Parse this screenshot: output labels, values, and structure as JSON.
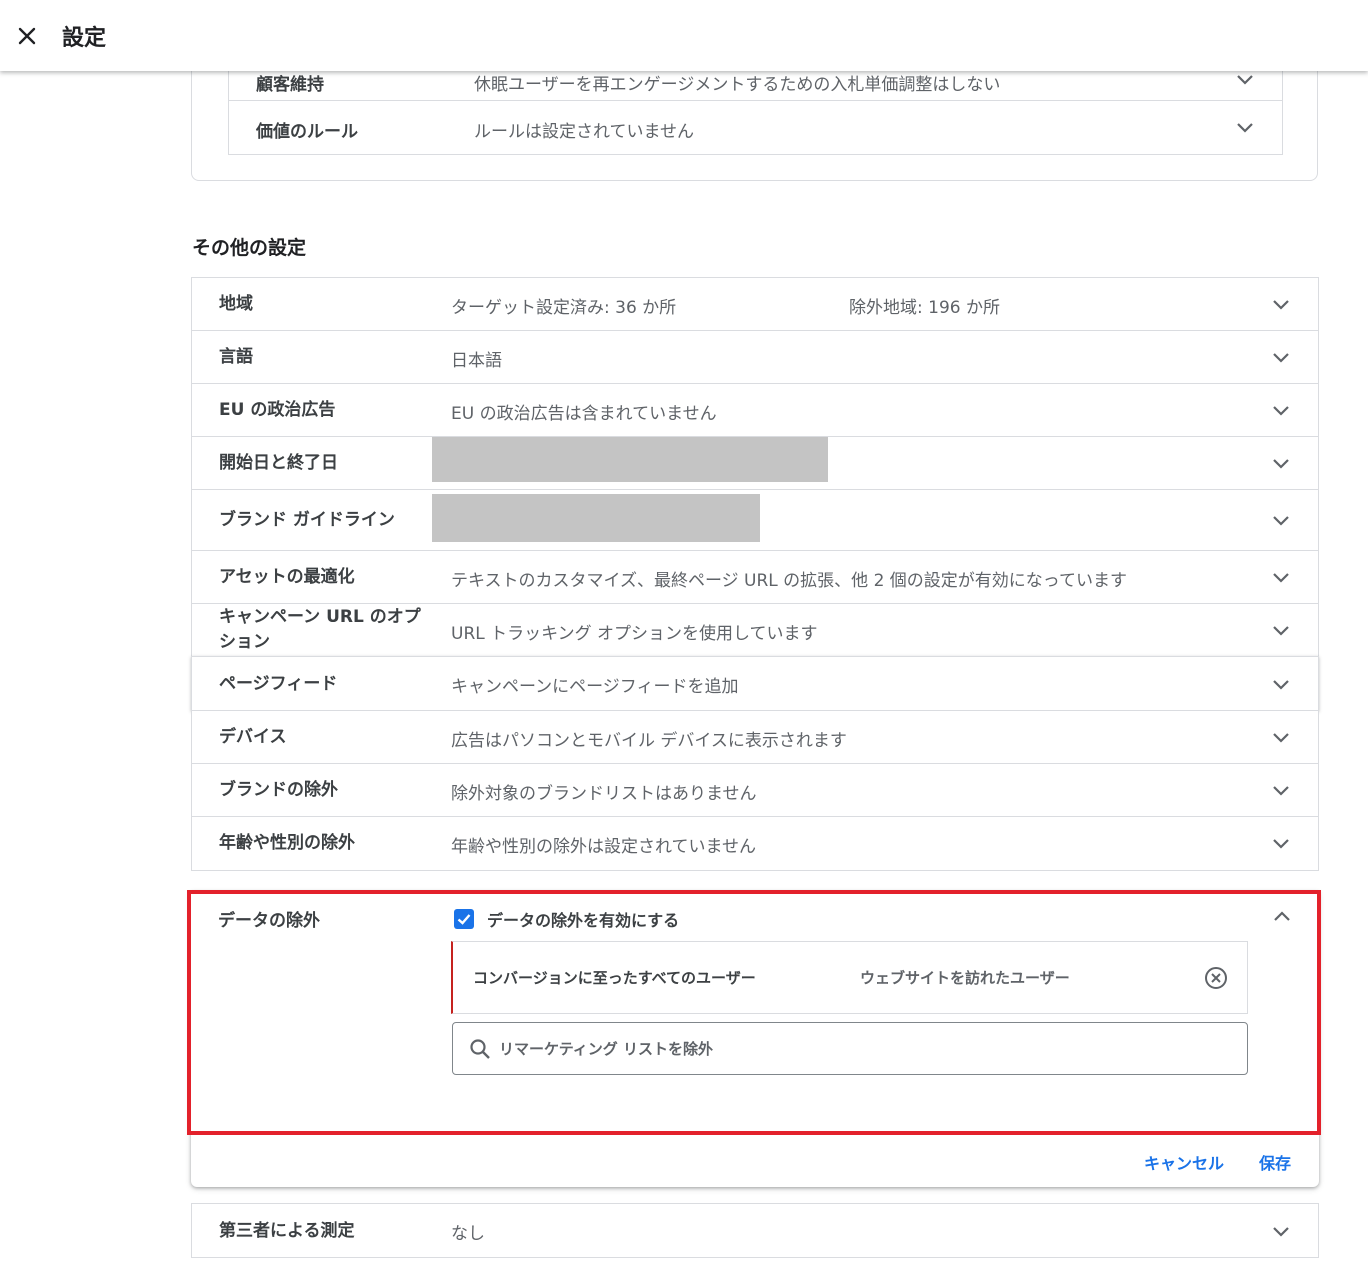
{
  "header": {
    "title": "設定",
    "close_icon": "close-icon"
  },
  "upper": {
    "partial_row": {
      "label": "顧客維持",
      "value": "休眠ユーザーを再エンゲージメントするための入札単価調整はしない"
    },
    "value_rules": {
      "label": "価値のルール",
      "value": "ルールは設定されていません"
    }
  },
  "other_settings": {
    "heading": "その他の設定",
    "rows": [
      {
        "label": "地域",
        "value": "ターゲット設定済み: 36 か所",
        "value2": "除外地域: 196 か所"
      },
      {
        "label": "言語",
        "value": "日本語"
      },
      {
        "label": "EU の政治広告",
        "value": "EU の政治広告は含まれていません"
      },
      {
        "label": "開始日と終了日",
        "value": ""
      },
      {
        "label": "ブランド ガイドライン",
        "value": ""
      },
      {
        "label": "アセットの最適化",
        "value": "テキストのカスタマイズ、最終ページ URL の拡張、他 2 個の設定が有効になっています"
      },
      {
        "label": "キャンペーン URL のオプション",
        "value": "URL トラッキング オプションを使用しています"
      },
      {
        "label": "ページフィード",
        "value": "キャンペーンにページフィードを追加"
      },
      {
        "label": "デバイス",
        "value": "広告はパソコンとモバイル デバイスに表示されます"
      },
      {
        "label": "ブランドの除外",
        "value": "除外対象のブランドリストはありません"
      },
      {
        "label": "年齢や性別の除外",
        "value": "年齢や性別の除外は設定されていません"
      }
    ]
  },
  "data_exclusion": {
    "label": "データの除外",
    "checkbox_label": "データの除外を有効にする",
    "checked": true,
    "selected_list": {
      "name": "コンバージョンに至ったすべてのユーザー",
      "source": "ウェブサイトを訪れたユーザー"
    },
    "search_placeholder": "リマーケティング リストを除外",
    "cancel_label": "キャンセル",
    "save_label": "保存"
  },
  "third_party": {
    "label": "第三者による測定",
    "value": "なし"
  },
  "colors": {
    "accent": "#1a73e8",
    "highlight": "#e3212b",
    "error_bar": "#c5221f"
  }
}
